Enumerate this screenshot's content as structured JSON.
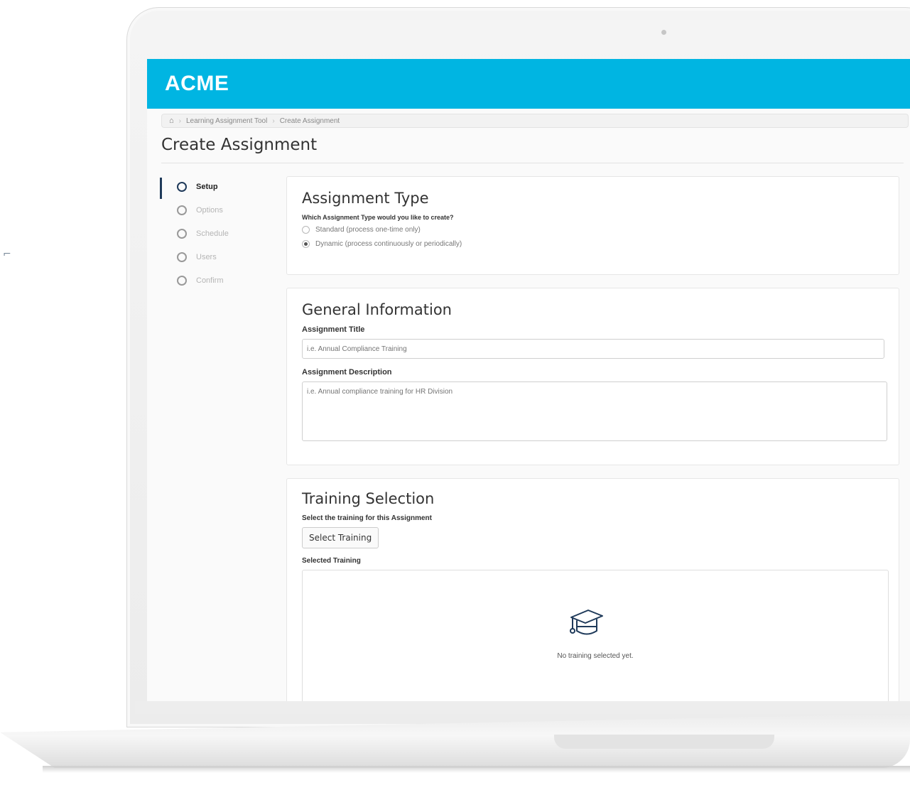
{
  "app": {
    "logo": "ACME",
    "header_color": "#00b5e2"
  },
  "breadcrumb": {
    "home_icon": "home-icon",
    "items": [
      "Learning Assignment Tool",
      "Create Assignment"
    ]
  },
  "page": {
    "title": "Create Assignment"
  },
  "stepper": {
    "steps": [
      "Setup",
      "Options",
      "Schedule",
      "Users",
      "Confirm"
    ],
    "active_step": "Setup"
  },
  "assignment_type": {
    "title": "Assignment Type",
    "question": "Which Assignment Type would you like to create?",
    "options": [
      {
        "label": "Standard (process one-time only)",
        "checked": false
      },
      {
        "label": "Dynamic (process continuously or periodically)",
        "checked": true
      }
    ]
  },
  "general_information": {
    "title": "General Information",
    "title_label": "Assignment Title",
    "title_placeholder": "i.e. Annual Compliance Training",
    "title_value": "",
    "description_label": "Assignment Description",
    "description_placeholder": "i.e. Annual compliance training for HR Division",
    "description_value": ""
  },
  "training_selection": {
    "title": "Training Selection",
    "prompt": "Select the training for this Assignment",
    "button_label": "Select Training",
    "selected_label": "Selected Training",
    "empty_icon": "graduation-cap-icon",
    "empty_text": "No training selected yet."
  }
}
